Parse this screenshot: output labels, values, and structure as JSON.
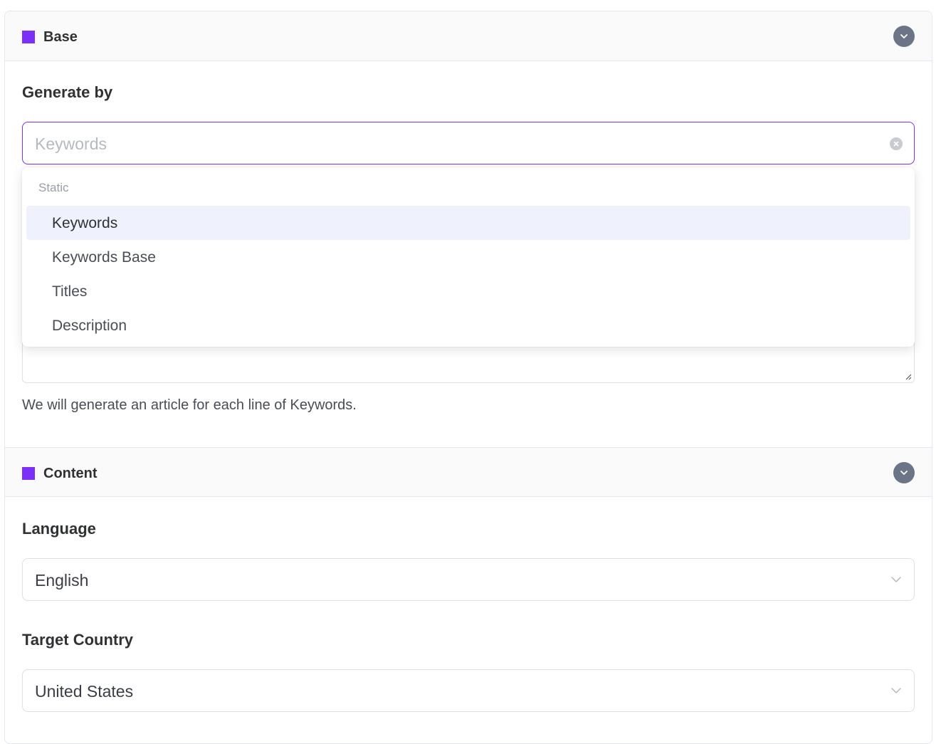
{
  "sections": {
    "base": {
      "title": "Base"
    },
    "content": {
      "title": "Content"
    }
  },
  "generate_by": {
    "label": "Generate by",
    "placeholder": "Keywords",
    "dropdown": {
      "group_label": "Static",
      "options": [
        "Keywords",
        "Keywords Base",
        "Titles",
        "Description"
      ],
      "selected": "Keywords"
    },
    "hint": "We will generate an article for each line of Keywords."
  },
  "language": {
    "label": "Language",
    "value": "English"
  },
  "target_country": {
    "label": "Target Country",
    "value": "United States"
  },
  "colors": {
    "accent": "#7b2ff7",
    "collapse_button": "#6b7587",
    "selected_option_bg": "#eff2fd"
  },
  "icons": {
    "collapse": "chevron-down-icon",
    "clear": "close-circle-icon",
    "select_arrow": "chevron-down-icon",
    "resize": "resize-handle-icon"
  }
}
